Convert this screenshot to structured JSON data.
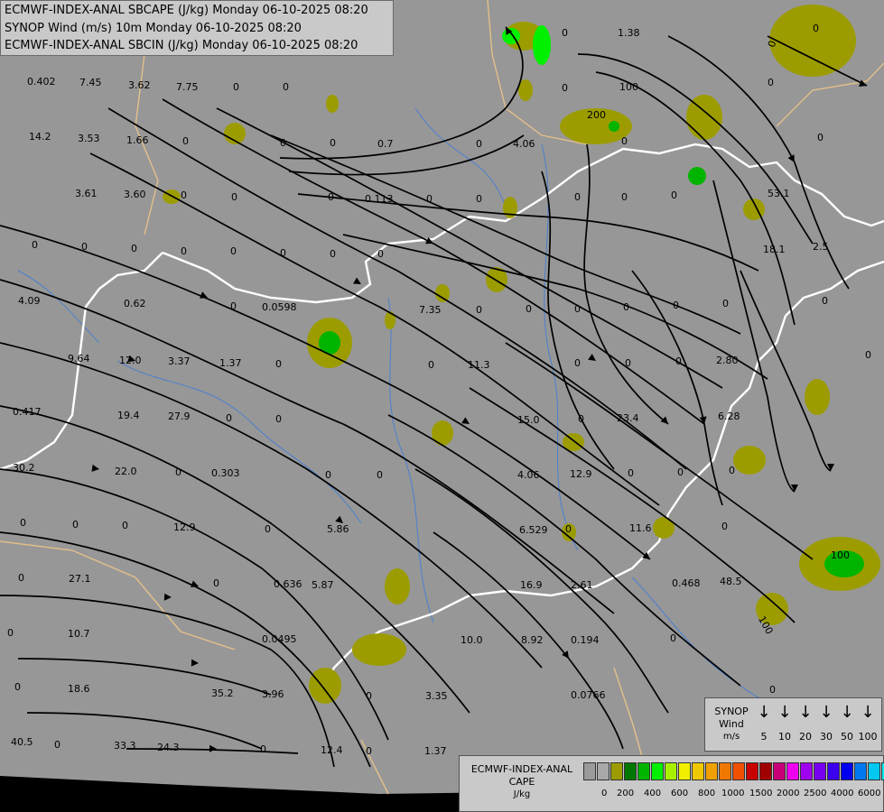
{
  "header": {
    "line1": "ECMWF-INDEX-ANAL SBCAPE (J/kg) Monday 06-10-2025 08:20",
    "line2": "SYNOP Wind (m/s) 10m Monday 06-10-2025 08:20",
    "line3": "ECMWF-INDEX-ANAL SBCIN (J/kg) Monday 06-10-2025 08:20"
  },
  "map_values": [
    "0.402",
    "7.45",
    "3.62",
    "7.75",
    "0",
    "0",
    "14.2",
    "3.53",
    "1.66",
    "0",
    "0",
    "0",
    "0.7",
    "0",
    "4.06",
    "0",
    "3.61",
    "3.60",
    "0",
    "0",
    "0",
    "0.113",
    "0",
    "0",
    "0",
    "0",
    "0",
    "0",
    "0",
    "0",
    "0",
    "0",
    "0",
    "0",
    "0",
    "4.09",
    "0.62",
    "0",
    "0.0598",
    "7.35",
    "0",
    "0",
    "0",
    "0",
    "0",
    "0",
    "9.64",
    "12.0",
    "3.37",
    "1.37",
    "0",
    "0",
    "11.3",
    "0",
    "0",
    "0",
    "2.80",
    "0.417",
    "19.4",
    "27.9",
    "0",
    "0",
    "15.0",
    "0",
    "23.4",
    "6.28",
    "30.2",
    "22.0",
    "0",
    "0.303",
    "0",
    "0",
    "4.06",
    "12.9",
    "0",
    "0",
    "0",
    "0",
    "0",
    "0",
    "12.9",
    "0",
    "5.86",
    "6.529",
    "0",
    "11.6",
    "0",
    "0",
    "27.1",
    "0",
    "0.636",
    "5.87",
    "16.9",
    "2.61",
    "0.468",
    "48.5",
    "0",
    "10.7",
    "0.0495",
    "10.0",
    "8.92",
    "0.194",
    "0",
    "0",
    "18.6",
    "35.2",
    "3.96",
    "0",
    "3.35",
    "0.0766",
    "0",
    "40.5",
    "0",
    "33.3",
    "24.3",
    "0",
    "12.4",
    "0",
    "1.37",
    "0",
    "1.38",
    "0",
    "100",
    "200",
    "100",
    "100",
    "0",
    "0",
    "0",
    "0",
    "53.1",
    "18.1",
    "2.5",
    "0",
    "0"
  ],
  "wind_legend": {
    "title_line1": "SYNOP",
    "title_line2": "Wind",
    "title_line3": "m/s",
    "arrow_icon": "down-arrow",
    "values": [
      "5",
      "10",
      "20",
      "30",
      "50",
      "100"
    ]
  },
  "cape_legend": {
    "title_line1": "ECMWF-INDEX-ANAL",
    "title_line2": "CAPE",
    "title_line3": "J/kg",
    "colors": [
      "#9a9a9a",
      "#a8a8a8",
      "#9c9c00",
      "#007800",
      "#00b400",
      "#00f000",
      "#a8f000",
      "#f0f000",
      "#f0c800",
      "#f0a000",
      "#f07800",
      "#f05000",
      "#c80000",
      "#a00000",
      "#c80078",
      "#f000f0",
      "#a000f0",
      "#7800f0",
      "#3c00f0",
      "#0000f0",
      "#0078f0",
      "#00c8f0",
      "#00f0f0",
      "#a0f0f0",
      "#ffffff"
    ],
    "labels": [
      "0",
      "200",
      "400",
      "600",
      "800",
      "1000",
      "1500",
      "2000",
      "2500",
      "4000",
      "6000"
    ]
  }
}
